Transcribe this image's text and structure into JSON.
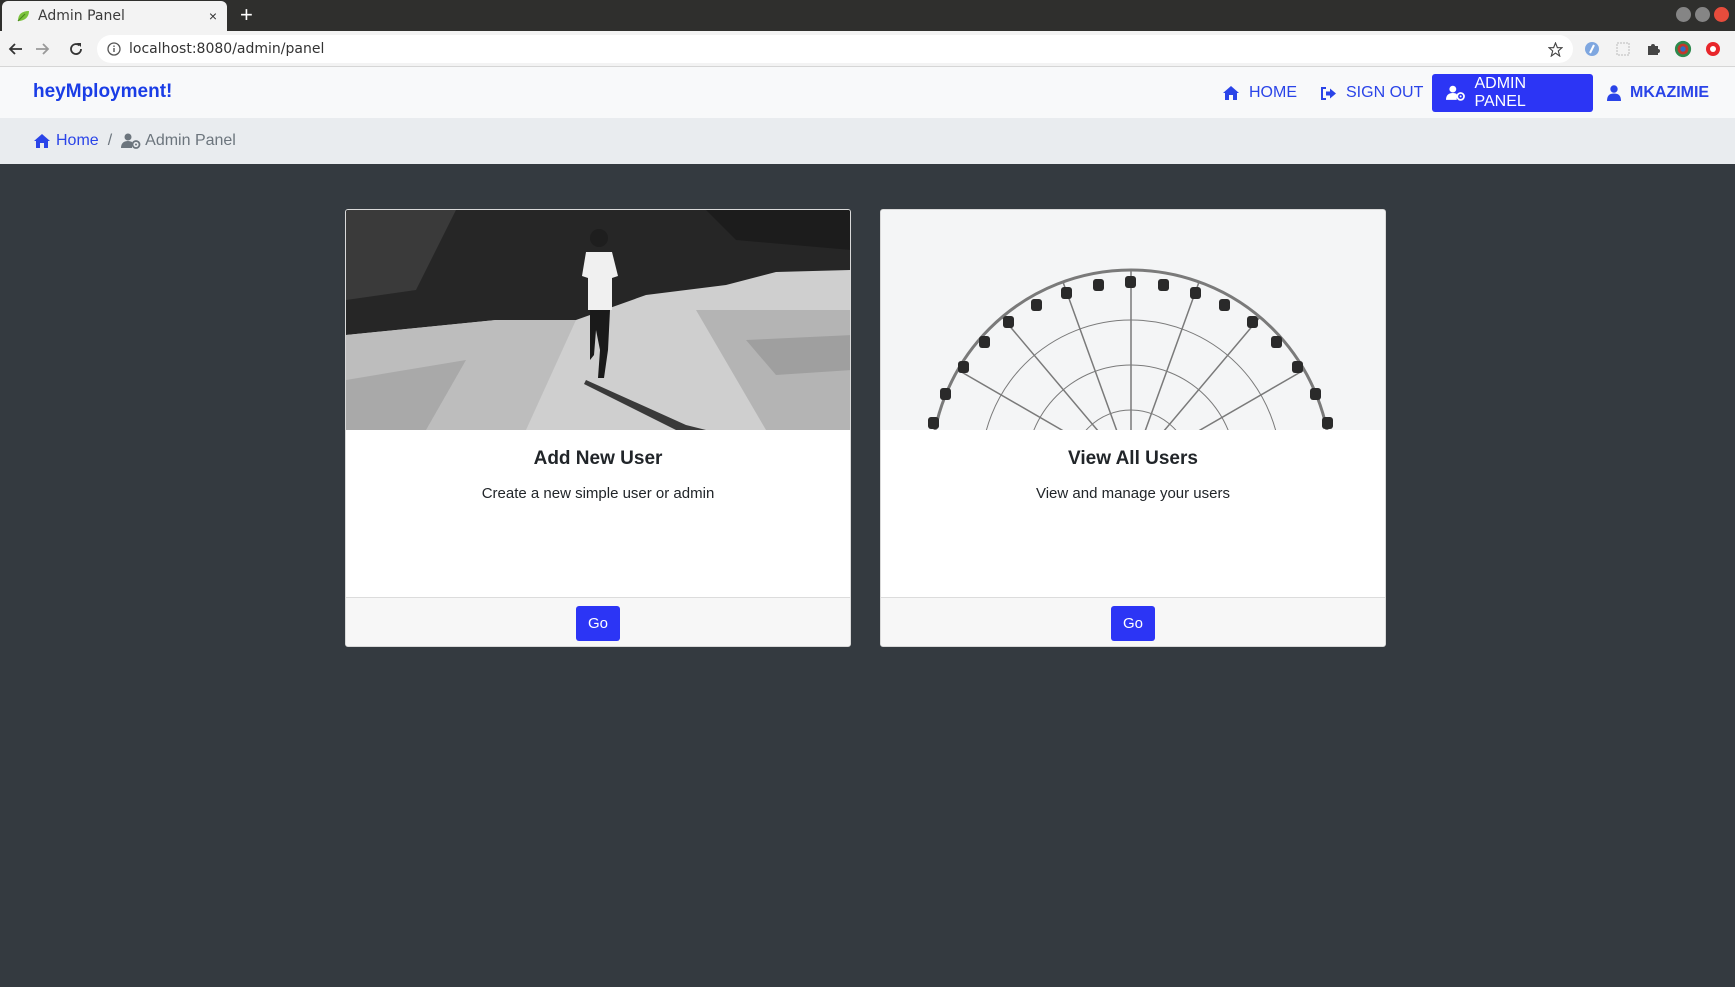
{
  "browser": {
    "tab_title": "Admin Panel",
    "tab_close": "×",
    "new_tab": "+",
    "url": "localhost:8080/admin/panel"
  },
  "navbar": {
    "brand": "heyMployment!",
    "items": [
      {
        "label": "HOME",
        "icon": "home-icon"
      },
      {
        "label": "SIGN OUT",
        "icon": "sign-out-icon"
      },
      {
        "label": "ADMIN PANEL",
        "icon": "user-cog-icon",
        "active": true
      },
      {
        "label": "MKAZIMIE",
        "icon": "user-icon"
      }
    ]
  },
  "breadcrumb": {
    "home": "Home",
    "separator": "/",
    "current": "Admin Panel"
  },
  "cards": [
    {
      "title": "Add New User",
      "text": "Create a new simple user or admin",
      "button": "Go",
      "image": "person-walking-photo"
    },
    {
      "title": "View All Users",
      "text": "View and manage your users",
      "button": "Go",
      "image": "ferris-wheel-photo"
    }
  ],
  "colors": {
    "accent": "#2c35f5",
    "link": "#2a44e8",
    "page_bg": "#343a40",
    "navbar_bg": "#f8f9fa",
    "breadcrumb_bg": "#e9ecef"
  }
}
